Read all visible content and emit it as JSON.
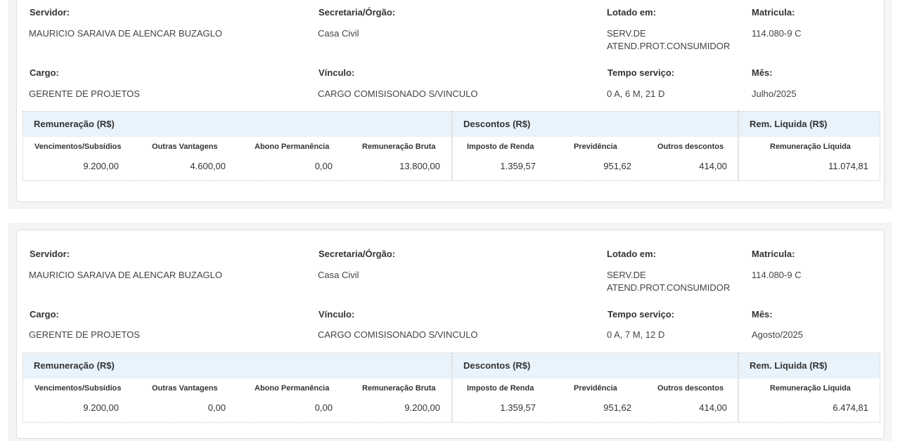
{
  "labels": {
    "servidor": "Servidor:",
    "secretaria": "Secretaria/Órgão:",
    "lotado": "Lotado em:",
    "matricula": "Matricula:",
    "cargo": "Cargo:",
    "vinculo": "Vínculo:",
    "tempo": "Tempo serviço:",
    "mes": "Mês:",
    "remuneracao": "Remuneração (R$)",
    "descontos": "Descontos (R$)",
    "liquida": "Rem. Liquida (R$)",
    "col_venc": "Vencimentos/Subsídios",
    "col_outras": "Outras Vantagens",
    "col_abono": "Abono Permanência",
    "col_bruta": "Remuneração Bruta",
    "col_ir": "Imposto de Renda",
    "col_prev": "Previdência",
    "col_outros_desc": "Outros descontos",
    "col_liquida": "Remuneração Líquida"
  },
  "records": [
    {
      "servidor": "MAURICIO SARAIVA DE ALENCAR BUZAGLO",
      "secretaria": "Casa Civil",
      "lotado_l1": "SERV.DE",
      "lotado_l2": "ATEND.PROT.CONSUMIDOR",
      "matricula": "114.080-9 C",
      "cargo": "GERENTE DE PROJETOS",
      "vinculo": "CARGO COMISISONADO S/VINCULO",
      "tempo": "0 A, 6 M, 21 D",
      "mes": "Julho/2025",
      "vencimentos": "9.200,00",
      "outras_vantagens": "4.600,00",
      "abono": "0,00",
      "bruta": "13.800,00",
      "ir": "1.359,57",
      "previdencia": "951,62",
      "outros_descontos": "414,00",
      "liquida": "11.074,81"
    },
    {
      "servidor": "MAURICIO SARAIVA DE ALENCAR BUZAGLO",
      "secretaria": "Casa Civil",
      "lotado_l1": "SERV.DE",
      "lotado_l2": "ATEND.PROT.CONSUMIDOR",
      "matricula": "114.080-9 C",
      "cargo": "GERENTE DE PROJETOS",
      "vinculo": "CARGO COMISISONADO S/VINCULO",
      "tempo": "0 A, 7 M, 12 D",
      "mes": "Agosto/2025",
      "vencimentos": "9.200,00",
      "outras_vantagens": "0,00",
      "abono": "0,00",
      "bruta": "9.200,00",
      "ir": "1.359,57",
      "previdencia": "951,62",
      "outros_descontos": "414,00",
      "liquida": "6.474,81"
    }
  ]
}
